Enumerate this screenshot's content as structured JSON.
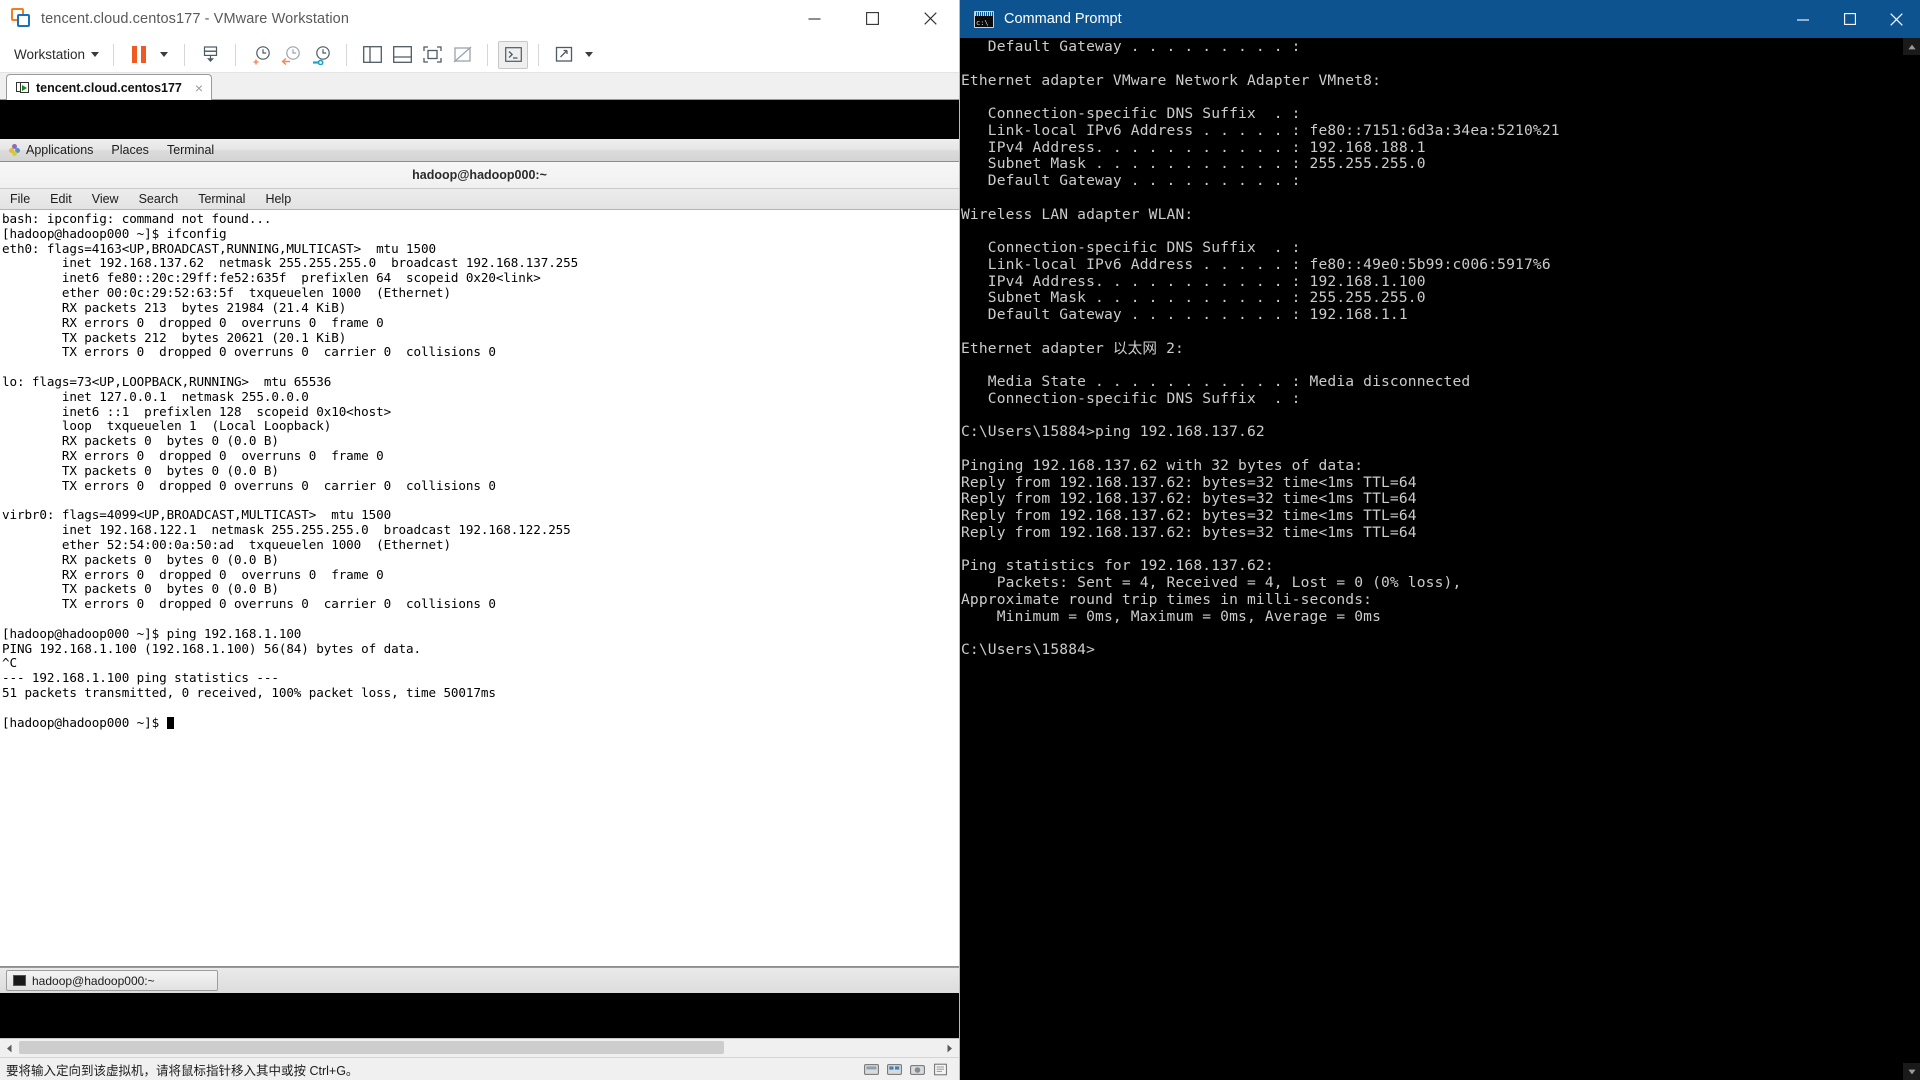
{
  "vmware": {
    "title": "tencent.cloud.centos177 - VMware Workstation",
    "window_buttons": {
      "minimize": "minimize-button",
      "maximize": "maximize-button",
      "close": "close-button"
    },
    "toolbar": {
      "menu_label": "Workstation",
      "icons": [
        "pause-vm-icon",
        "pause-dropdown-icon",
        "snapshot-manager-icon",
        "take-snapshot-icon",
        "revert-snapshot-icon",
        "manage-snapshots-icon",
        "show-library-icon",
        "show-thumbnails-icon",
        "fullscreen-icon",
        "unity-mode-icon",
        "console-view-icon",
        "stretch-icon"
      ]
    },
    "tab": {
      "label": "tencent.cloud.centos177",
      "close": "×"
    },
    "guest": {
      "panel": {
        "applications": "Applications",
        "places": "Places",
        "terminal": "Terminal"
      },
      "terminal_window": {
        "title": "hadoop@hadoop000:~",
        "menu": [
          "File",
          "Edit",
          "View",
          "Search",
          "Terminal",
          "Help"
        ],
        "taskbar_item": "hadoop@hadoop000:~",
        "content": "bash: ipconfig: command not found...\n[hadoop@hadoop000 ~]$ ifconfig\neth0: flags=4163<UP,BROADCAST,RUNNING,MULTICAST>  mtu 1500\n        inet 192.168.137.62  netmask 255.255.255.0  broadcast 192.168.137.255\n        inet6 fe80::20c:29ff:fe52:635f  prefixlen 64  scopeid 0x20<link>\n        ether 00:0c:29:52:63:5f  txqueuelen 1000  (Ethernet)\n        RX packets 213  bytes 21984 (21.4 KiB)\n        RX errors 0  dropped 0  overruns 0  frame 0\n        TX packets 212  bytes 20621 (20.1 KiB)\n        TX errors 0  dropped 0 overruns 0  carrier 0  collisions 0\n\nlo: flags=73<UP,LOOPBACK,RUNNING>  mtu 65536\n        inet 127.0.0.1  netmask 255.0.0.0\n        inet6 ::1  prefixlen 128  scopeid 0x10<host>\n        loop  txqueuelen 1  (Local Loopback)\n        RX packets 0  bytes 0 (0.0 B)\n        RX errors 0  dropped 0  overruns 0  frame 0\n        TX packets 0  bytes 0 (0.0 B)\n        TX errors 0  dropped 0 overruns 0  carrier 0  collisions 0\n\nvirbr0: flags=4099<UP,BROADCAST,MULTICAST>  mtu 1500\n        inet 192.168.122.1  netmask 255.255.255.0  broadcast 192.168.122.255\n        ether 52:54:00:0a:50:ad  txqueuelen 1000  (Ethernet)\n        RX packets 0  bytes 0 (0.0 B)\n        RX errors 0  dropped 0  overruns 0  frame 0\n        TX packets 0  bytes 0 (0.0 B)\n        TX errors 0  dropped 0 overruns 0  carrier 0  collisions 0\n\n[hadoop@hadoop000 ~]$ ping 192.168.1.100\nPING 192.168.1.100 (192.168.1.100) 56(84) bytes of data.\n^C\n--- 192.168.1.100 ping statistics ---\n51 packets transmitted, 0 received, 100% packet loss, time 50017ms\n\n[hadoop@hadoop000 ~]$ "
      }
    },
    "status_bar": {
      "text": "要将输入定向到该虚拟机，请将鼠标指针移入其中或按 Ctrl+G。",
      "icons": [
        "hard-disk-icon",
        "network-icon",
        "camera-icon",
        "printer-icon"
      ]
    }
  },
  "cmd": {
    "title": "Command Prompt",
    "window_buttons": {
      "minimize": "minimize-button",
      "maximize": "maximize-button",
      "close": "close-button"
    },
    "content": "   Default Gateway . . . . . . . . . :\n\nEthernet adapter VMware Network Adapter VMnet8:\n\n   Connection-specific DNS Suffix  . :\n   Link-local IPv6 Address . . . . . : fe80::7151:6d3a:34ea:5210%21\n   IPv4 Address. . . . . . . . . . . : 192.168.188.1\n   Subnet Mask . . . . . . . . . . . : 255.255.255.0\n   Default Gateway . . . . . . . . . :\n\nWireless LAN adapter WLAN:\n\n   Connection-specific DNS Suffix  . :\n   Link-local IPv6 Address . . . . . : fe80::49e0:5b99:c006:5917%6\n   IPv4 Address. . . . . . . . . . . : 192.168.1.100\n   Subnet Mask . . . . . . . . . . . : 255.255.255.0\n   Default Gateway . . . . . . . . . : 192.168.1.1\n\nEthernet adapter 以太网 2:\n\n   Media State . . . . . . . . . . . : Media disconnected\n   Connection-specific DNS Suffix  . :\n\nC:\\Users\\15884>ping 192.168.137.62\n\nPinging 192.168.137.62 with 32 bytes of data:\nReply from 192.168.137.62: bytes=32 time<1ms TTL=64\nReply from 192.168.137.62: bytes=32 time<1ms TTL=64\nReply from 192.168.137.62: bytes=32 time<1ms TTL=64\nReply from 192.168.137.62: bytes=32 time<1ms TTL=64\n\nPing statistics for 192.168.137.62:\n    Packets: Sent = 4, Received = 4, Lost = 0 (0% loss),\nApproximate round trip times in milli-seconds:\n    Minimum = 0ms, Maximum = 0ms, Average = 0ms\n\nC:\\Users\\15884>",
    "colors": {
      "titlebar": "#0d5390",
      "text": "#cccccc",
      "background": "#000000"
    }
  }
}
